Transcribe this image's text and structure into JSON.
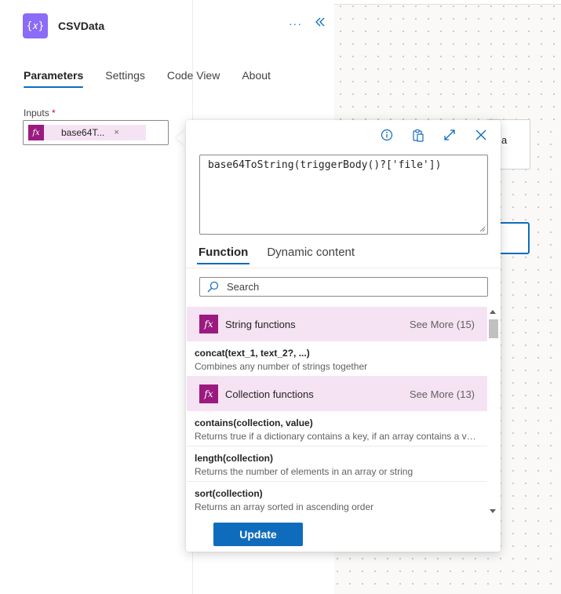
{
  "action": {
    "icon": "variable-icon",
    "icon_glyph": "{𝑥}",
    "title": "CSVData",
    "more_label": "···",
    "collapse_label": "«"
  },
  "tabs": [
    {
      "label": "Parameters",
      "active": true
    },
    {
      "label": "Settings",
      "active": false
    },
    {
      "label": "Code View",
      "active": false
    },
    {
      "label": "About",
      "active": false
    }
  ],
  "inputs": {
    "label": "Inputs",
    "required_mark": "*",
    "token": {
      "icon_glyph": "fx",
      "text": "base64T...",
      "close": "×"
    }
  },
  "background": {
    "card_fragment": "a"
  },
  "expression_editor": {
    "tools": [
      "info-icon",
      "paste-icon",
      "expand-icon",
      "close-icon"
    ],
    "expression": "base64ToString(triggerBody()?['file'])",
    "tabs": [
      {
        "label": "Function",
        "active": true
      },
      {
        "label": "Dynamic content",
        "active": false
      }
    ],
    "search_placeholder": "Search",
    "groups": [
      {
        "icon_glyph": "fx",
        "title": "String functions",
        "see_more": "See More (15)",
        "items": [
          {
            "name": "concat(text_1, text_2?, ...)",
            "description": "Combines any number of strings together"
          }
        ]
      },
      {
        "icon_glyph": "fx",
        "title": "Collection functions",
        "see_more": "See More (13)",
        "items": [
          {
            "name": "contains(collection, value)",
            "description": "Returns true if a dictionary contains a key, if an array contains a val..."
          },
          {
            "name": "length(collection)",
            "description": "Returns the number of elements in an array or string"
          },
          {
            "name": "sort(collection)",
            "description": "Returns an array sorted in ascending order"
          }
        ]
      }
    ],
    "update_label": "Update"
  },
  "colors": {
    "accent": "#0f6cbd",
    "action_icon": "#8a6cf7",
    "function_icon": "#9b1a80",
    "group_bg": "#f5e3f3"
  }
}
